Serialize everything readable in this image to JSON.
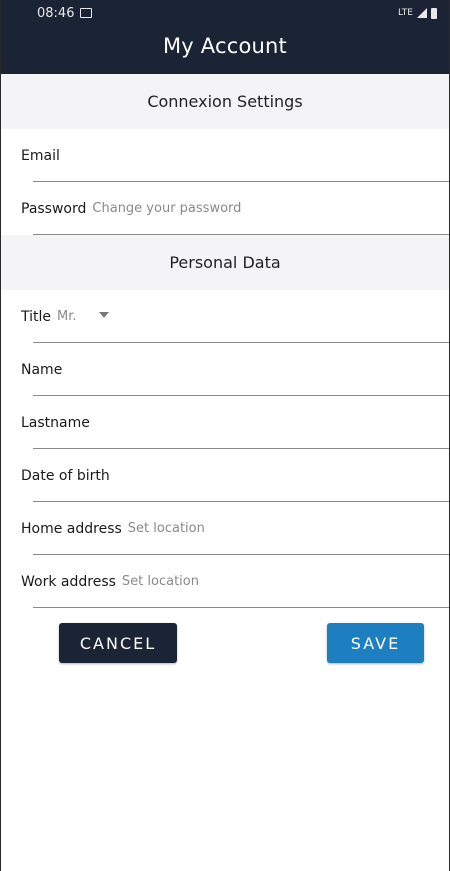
{
  "status_bar": {
    "time": "08:46",
    "network": "LTE"
  },
  "header": {
    "title": "My Account"
  },
  "sections": {
    "connexion": {
      "title": "Connexion Settings",
      "email_label": "Email",
      "password_label": "Password",
      "password_placeholder": "Change your password"
    },
    "personal": {
      "title": "Personal Data",
      "title_label": "Title",
      "title_value": "Mr.",
      "name_label": "Name",
      "lastname_label": "Lastname",
      "dob_label": "Date of birth",
      "home_label": "Home address",
      "home_placeholder": "Set location",
      "work_label": "Work address",
      "work_placeholder": "Set location"
    }
  },
  "buttons": {
    "cancel_label": "CANCEL",
    "save_label": "SAVE"
  },
  "colors": {
    "header_bg": "#1b2434",
    "save_button": "#1e7fc0",
    "section_bg": "#f4f4f6"
  }
}
